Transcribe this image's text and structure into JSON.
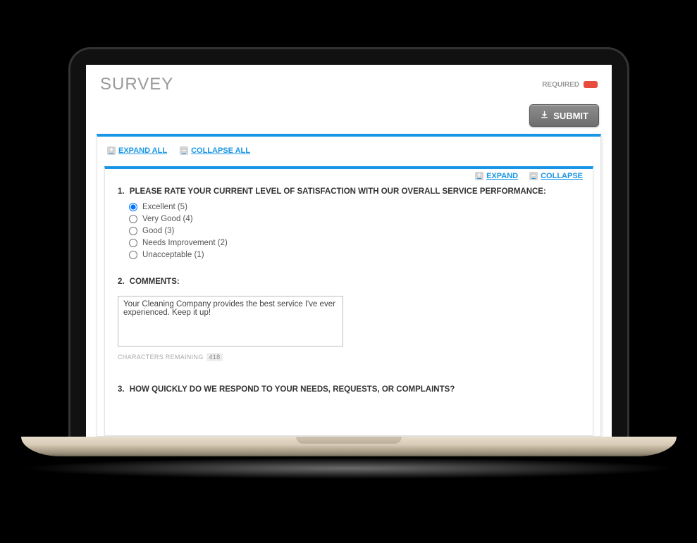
{
  "header": {
    "title": "SURVEY",
    "required_label": "REQUIRED"
  },
  "actions": {
    "submit_label": "SUBMIT"
  },
  "toolbar": {
    "expand_all": "EXPAND ALL",
    "collapse_all": "COLLAPSE ALL",
    "expand": "EXPAND",
    "collapse": "COLLAPSE"
  },
  "questions": [
    {
      "num": "1.",
      "text": "PLEASE RATE YOUR CURRENT LEVEL OF SATISFACTION WITH OUR OVERALL SERVICE PERFORMANCE:",
      "options": [
        {
          "label": "Excellent (5)",
          "selected": true
        },
        {
          "label": "Very Good (4)",
          "selected": false
        },
        {
          "label": "Good (3)",
          "selected": false
        },
        {
          "label": "Needs Improvement (2)",
          "selected": false
        },
        {
          "label": "Unacceptable (1)",
          "selected": false
        }
      ]
    },
    {
      "num": "2.",
      "text": "COMMENTS:",
      "textarea_value": "Your Cleaning Company provides the best service I've ever experienced. Keep it up!",
      "chars_remaining_label": "CHARACTERS REMAINING",
      "chars_remaining": "418"
    },
    {
      "num": "3.",
      "text": "HOW QUICKLY DO WE RESPOND TO YOUR NEEDS, REQUESTS, OR COMPLAINTS?"
    }
  ]
}
